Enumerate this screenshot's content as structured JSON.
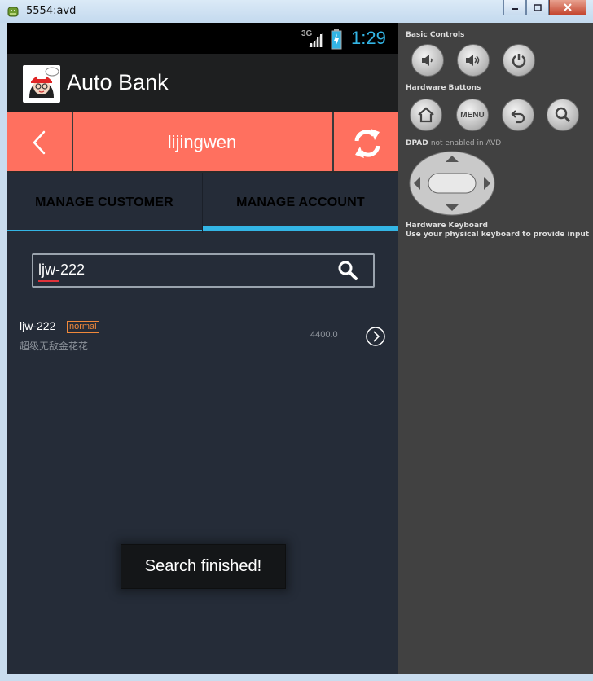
{
  "window": {
    "title": "5554:avd"
  },
  "status_bar": {
    "network": "3G",
    "time": "1:29"
  },
  "app_bar": {
    "title": "Auto Bank"
  },
  "header": {
    "username": "lijingwen"
  },
  "tabs": [
    {
      "label": "MANAGE CUSTOMER"
    },
    {
      "label": "MANAGE ACCOUNT"
    }
  ],
  "search": {
    "value": "ljw-222"
  },
  "results": [
    {
      "name": "ljw-222",
      "badge": "normal",
      "owner": "超级无敌金花花",
      "amount": "4400.0"
    }
  ],
  "toast": {
    "message": "Search finished!"
  },
  "panel": {
    "basic_controls": "Basic Controls",
    "hardware_buttons": "Hardware Buttons",
    "menu_label": "MENU",
    "dpad_label": "DPAD",
    "dpad_note": "not enabled in AVD",
    "keyboard_title": "Hardware Keyboard",
    "keyboard_note": "Use your physical keyboard to provide input"
  },
  "colors": {
    "accent": "#33b5e5",
    "header": "#ff705f",
    "badge": "#f0883a",
    "background": "#252c38",
    "panel": "#414141"
  }
}
